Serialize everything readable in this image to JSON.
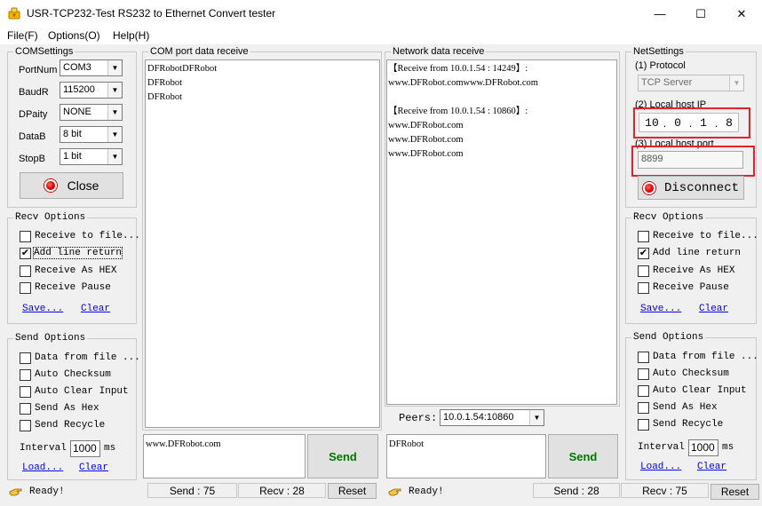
{
  "window": {
    "title": "USR-TCP232-Test  RS232 to Ethernet Convert tester",
    "minimize": "—",
    "maximize": "☐",
    "close": "✕"
  },
  "menu": {
    "file": "File(F)",
    "options": "Options(O)",
    "help": "Help(H)"
  },
  "com_settings": {
    "title": "COMSettings",
    "port_label": "PortNum",
    "port_value": "COM3",
    "baud_label": "BaudR",
    "baud_value": "115200",
    "parity_label": "DPaity",
    "parity_value": "NONE",
    "databits_label": "DataB",
    "databits_value": "8 bit",
    "stopbits_label": "StopB",
    "stopbits_value": "1 bit",
    "close_button": "Close"
  },
  "left_recv_options": {
    "title": "Recv Options",
    "receive_to_file": "Receive to file...",
    "add_line_return": "Add line return",
    "receive_as_hex": "Receive As HEX",
    "receive_pause": "Receive Pause",
    "save": "Save...",
    "clear": "Clear",
    "add_line_return_checked": true
  },
  "left_send_options": {
    "title": "Send Options",
    "data_from_file": "Data from file ...",
    "auto_checksum": "Auto Checksum",
    "auto_clear_input": "Auto Clear Input",
    "send_as_hex": "Send As Hex",
    "send_recycle": "Send Recycle",
    "interval_label": "Interval",
    "interval_value": "1000",
    "interval_unit": "ms",
    "load": "Load...",
    "clear": "Clear"
  },
  "com_receive": {
    "title": "COM port data receive",
    "lines": [
      "DFRobotDFRobot",
      "DFRobot",
      "DFRobot"
    ]
  },
  "com_send": {
    "text": "www.DFRobot.com",
    "send_button": "Send"
  },
  "net_receive": {
    "title": "Network data receive",
    "lines": [
      "【Receive from 10.0.1.54 : 14249】:",
      "www.DFRobot.comwww.DFRobot.com",
      "",
      "【Receive from 10.0.1.54 : 10860】:",
      "www.DFRobot.com",
      "www.DFRobot.com",
      "www.DFRobot.com"
    ]
  },
  "peers": {
    "label": "Peers:",
    "value": "10.0.1.54:10860"
  },
  "net_send": {
    "text": "DFRobot",
    "send_button": "Send"
  },
  "net_settings": {
    "title": "NetSettings",
    "protocol_label": "(1) Protocol",
    "protocol_value": "TCP Server",
    "local_ip_label": "(2) Local host IP",
    "ip_octets": [
      "10",
      "0",
      "1",
      "8"
    ],
    "local_port_label": "(3) Local host port",
    "local_port_value": "8899",
    "disconnect_button": "Disconnect"
  },
  "right_recv_options": {
    "title": "Recv Options",
    "receive_to_file": "Receive to file...",
    "add_line_return": "Add line return",
    "receive_as_hex": "Receive As HEX",
    "receive_pause": "Receive Pause",
    "save": "Save...",
    "clear": "Clear",
    "add_line_return_checked": true
  },
  "right_send_options": {
    "title": "Send Options",
    "data_from_file": "Data from file ...",
    "auto_checksum": "Auto Checksum",
    "auto_clear_input": "Auto Clear Input",
    "send_as_hex": "Send As Hex",
    "send_recycle": "Send Recycle",
    "interval_label": "Interval",
    "interval_value": "1000",
    "interval_unit": "ms",
    "load": "Load...",
    "clear": "Clear"
  },
  "status_left": {
    "ready": "Ready!",
    "send": "Send : 75",
    "recv": "Recv : 28",
    "reset": "Reset"
  },
  "status_right": {
    "ready": "Ready!",
    "send": "Send : 28",
    "recv": "Recv : 75",
    "reset": "Reset"
  },
  "colors": {
    "highlight": "#e8202a",
    "send_text": "#007700",
    "link": "#0000ee"
  }
}
